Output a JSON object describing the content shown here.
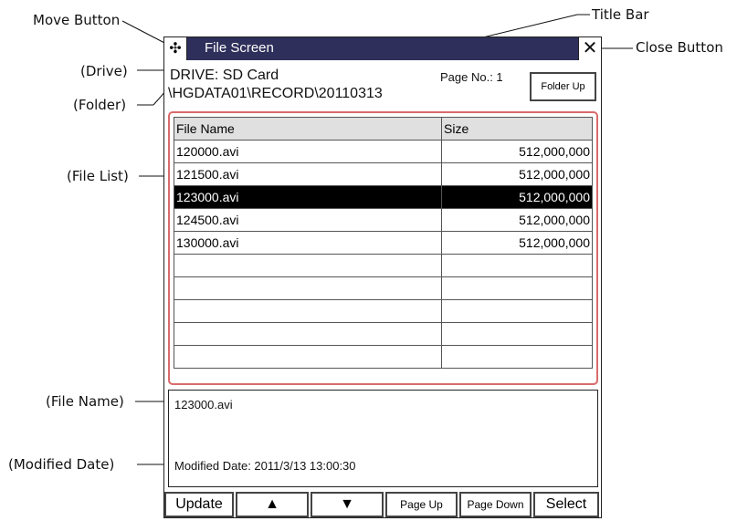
{
  "callouts": {
    "move_button": "Move Button",
    "title_bar": "Title Bar",
    "close_button": "Close Button",
    "drive": "(Drive)",
    "folder": "(Folder)",
    "file_list": "(File List)",
    "file_name": "(File Name)",
    "modified_date": "(Modified Date)"
  },
  "window": {
    "title": "File Screen",
    "move_icon": "✣",
    "close_icon": "✕",
    "drive": "DRIVE: SD Card",
    "folder": "\\HGDATA01\\RECORD\\20110313",
    "page_no": "Page No.: 1",
    "folder_up": "Folder Up"
  },
  "file_list": {
    "headers": [
      "File Name",
      "Size"
    ],
    "rows": [
      {
        "name": "120000.avi",
        "size": "512,000,000"
      },
      {
        "name": "121500.avi",
        "size": "512,000,000"
      },
      {
        "name": "123000.avi",
        "size": "512,000,000"
      },
      {
        "name": "124500.avi",
        "size": "512,000,000"
      },
      {
        "name": "130000.avi",
        "size": "512,000,000"
      },
      {
        "name": "",
        "size": ""
      },
      {
        "name": "",
        "size": ""
      },
      {
        "name": "",
        "size": ""
      },
      {
        "name": "",
        "size": ""
      },
      {
        "name": "",
        "size": ""
      }
    ],
    "selected_index": 2
  },
  "info": {
    "file_name": "123000.avi",
    "modified_date": "Modified Date: 2011/3/13 13:00:30"
  },
  "buttons": {
    "update": "Update",
    "up": "▲",
    "down": "▼",
    "page_up": "Page Up",
    "page_down": "Page Down",
    "select": "Select"
  },
  "colors": {
    "title_bar": "#2e2f5a",
    "file_list_outline": "#d96b6b",
    "selected_row": "#000000"
  }
}
